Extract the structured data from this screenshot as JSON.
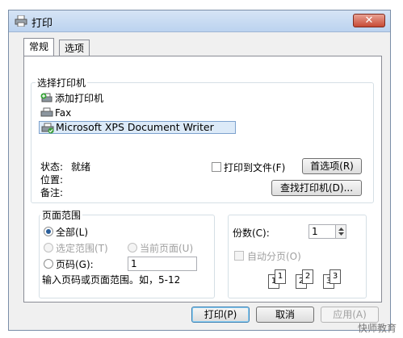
{
  "window": {
    "title": "打印",
    "close_label": "✕"
  },
  "tabs": [
    {
      "label": "常规"
    },
    {
      "label": "选项"
    }
  ],
  "printer_group": {
    "label": "选择打印机",
    "printers": [
      {
        "name": "添加打印机",
        "icon": "add-printer-icon"
      },
      {
        "name": "Fax",
        "icon": "fax-printer-icon"
      },
      {
        "name": "Microsoft XPS Document Writer",
        "icon": "xps-printer-icon"
      }
    ],
    "status_label": "状态:",
    "status_value": "就绪",
    "location_label": "位置:",
    "comment_label": "备注:",
    "print_to_file": "打印到文件(F)",
    "preferences_button": "首选项(R)",
    "find_printer_button": "查找打印机(D)..."
  },
  "page_range": {
    "label": "页面范围",
    "all": "全部(L)",
    "selection": "选定范围(T)",
    "current_page": "当前页面(U)",
    "pages": "页码(G):",
    "pages_value": "1",
    "hint": "输入页码或页面范围。如，5-12"
  },
  "copies": {
    "label": "份数(C):",
    "value": "1",
    "collate": "自动分页(O)",
    "pages": [
      "1",
      "1",
      "2",
      "2",
      "3",
      "3"
    ]
  },
  "buttons": {
    "print": "打印(P)",
    "cancel": "取消",
    "apply": "应用(A)"
  },
  "watermark": "快师教育"
}
